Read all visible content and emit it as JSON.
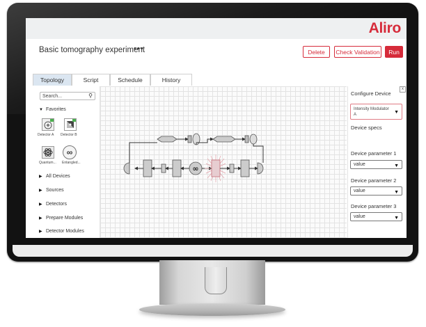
{
  "app": {
    "logo": "Aliro",
    "title": "Basic tomography experiment",
    "more": "•••"
  },
  "toolbar": {
    "delete_label": "Delete",
    "check_label": "Check Validation",
    "run_label": "Run"
  },
  "tabs": [
    {
      "label": "Topology",
      "active": true
    },
    {
      "label": "Script"
    },
    {
      "label": "Schedule"
    },
    {
      "label": "History"
    }
  ],
  "sidebar": {
    "search_placeholder": "Search...",
    "favorites_label": "Favorites",
    "favorites": [
      {
        "label": "Detector A",
        "icon": "detector-a-icon"
      },
      {
        "label": "Detector B",
        "icon": "detector-b-icon"
      },
      {
        "label": "Quantum...",
        "icon": "quantum-icon"
      },
      {
        "label": "Entangled...",
        "icon": "entangled-icon"
      }
    ],
    "sections": [
      {
        "label": "All Devices"
      },
      {
        "label": "Sources"
      },
      {
        "label": "Detectors"
      },
      {
        "label": "Prepare Modules"
      },
      {
        "label": "Detector Modules"
      }
    ]
  },
  "config": {
    "title": "Configure Device",
    "close": "x",
    "selected_device": "Intensity Modulator A",
    "specs_label": "Device specs",
    "params": [
      {
        "label": "Device parameter 1",
        "value": "value"
      },
      {
        "label": "Device parameter 2",
        "value": "value"
      },
      {
        "label": "Device parameter 3",
        "value": "value"
      }
    ]
  },
  "colors": {
    "accent": "#d62b3a",
    "tab_active": "#dbe6f1",
    "grid": "#e3e3e3"
  }
}
